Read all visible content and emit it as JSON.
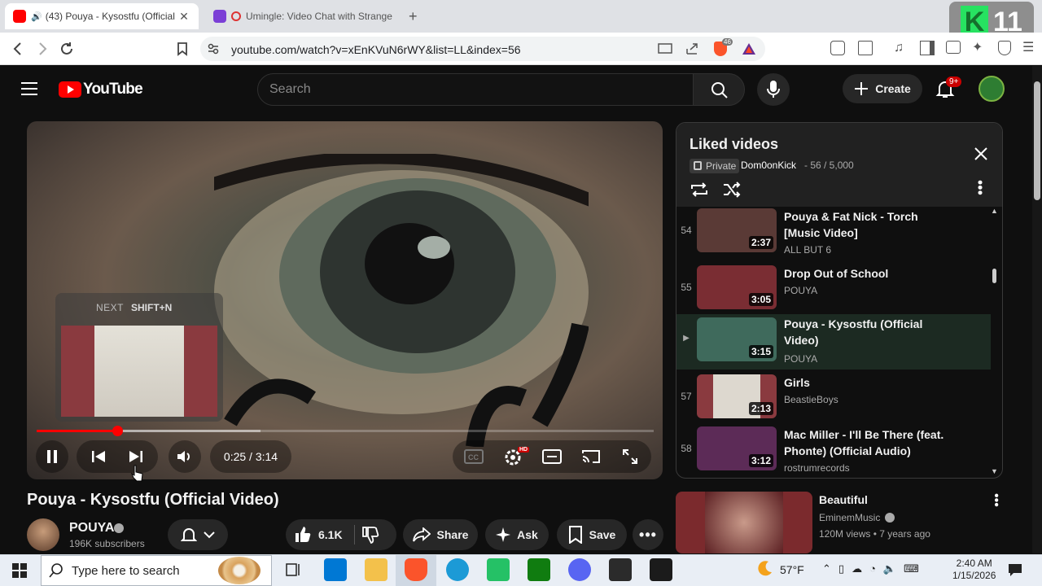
{
  "browser": {
    "tabs": [
      {
        "title": "(43) Pouya - Kysostfu (Official",
        "favicon_color": "#ff0000"
      },
      {
        "title": "Umingle: Video Chat with Strange",
        "favicon_color": "#7b3fd6"
      }
    ],
    "url": "youtube.com/watch?v=xEnKVuN6rWY&list=LL&index=56",
    "brave_badge": "46",
    "overlay_badge": "11"
  },
  "header": {
    "logo_text": "YouTube",
    "search_placeholder": "Search",
    "create_label": "Create",
    "notification_count": "9+"
  },
  "player": {
    "current_time": "0:25 / 3:14",
    "progress_fraction": 0.131,
    "next_label": "NEXT",
    "next_shortcut": "SHIFT+N"
  },
  "video": {
    "title": "Pouya - Kysostfu (Official Video)",
    "channel": "POUYA",
    "subscribers": "196K subscribers",
    "likes": "6.1K",
    "share_label": "Share",
    "ask_label": "Ask",
    "save_label": "Save"
  },
  "playlist": {
    "title": "Liked videos",
    "privacy": "Private",
    "owner": "Dom0onKick",
    "position": "- 56 / 5,000",
    "items": [
      {
        "index": "54",
        "title": "Pouya & Fat Nick - Torch [Music Video]",
        "channel": "ALL BUT 6",
        "duration": "2:37",
        "color": "#5a3a36"
      },
      {
        "index": "55",
        "title": "Drop Out of School",
        "channel": "POUYA",
        "duration": "3:05",
        "color": "#7a2d33"
      },
      {
        "index": "▶",
        "title": "Pouya - Kysostfu (Official Video)",
        "channel": "POUYA",
        "duration": "3:15",
        "color": "#3f6a5c"
      },
      {
        "index": "57",
        "title": "Girls",
        "channel": "BeastieBoys",
        "duration": "2:13",
        "color": "#8a3a3f"
      },
      {
        "index": "58",
        "title": "Mac Miller - I'll Be There (feat. Phonte) (Official Audio)",
        "channel": "rostrumrecords",
        "duration": "3:12",
        "color": "#5c2b57"
      }
    ]
  },
  "recommendation": {
    "title": "Beautiful",
    "channel": "EminemMusic",
    "meta": "120M views • 7 years ago"
  },
  "taskbar": {
    "search_text": "Type here to search",
    "temperature": "57°F",
    "time": "2:40 AM",
    "date": "1/15/2026"
  }
}
